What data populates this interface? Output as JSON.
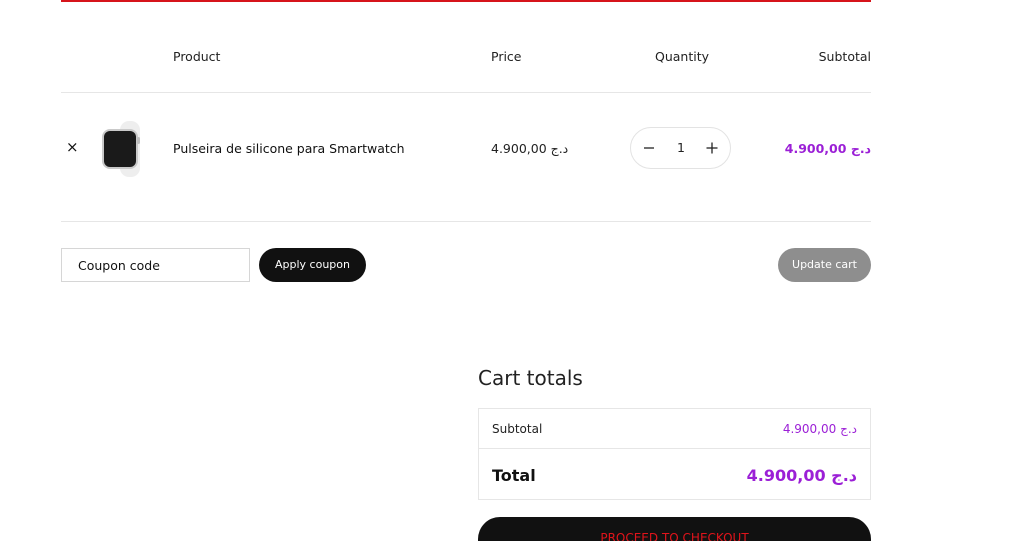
{
  "table": {
    "headers": {
      "product": "Product",
      "price": "Price",
      "quantity": "Quantity",
      "subtotal": "Subtotal"
    },
    "items": [
      {
        "remove": "×",
        "image_icon": "smartwatch-icon",
        "name": "Pulseira de silicone para Smartwatch",
        "price": "4.900,00 د.ج",
        "quantity": "1",
        "subtotal": "4.900,00 د.ج"
      }
    ]
  },
  "actions": {
    "coupon_placeholder": "Coupon code",
    "apply_coupon": "Apply coupon",
    "update_cart": "Update cart"
  },
  "totals": {
    "title": "Cart totals",
    "subtotal_label": "Subtotal",
    "subtotal_value": "4.900,00 د.ج",
    "total_label": "Total",
    "total_value": "4.900,00 د.ج",
    "checkout": "PROCEED TO CHECKOUT"
  },
  "colors": {
    "accent_red": "#d6141b",
    "price_purple": "#9b1fd6",
    "button_dark": "#111111",
    "button_gray": "#8e8e8e"
  }
}
